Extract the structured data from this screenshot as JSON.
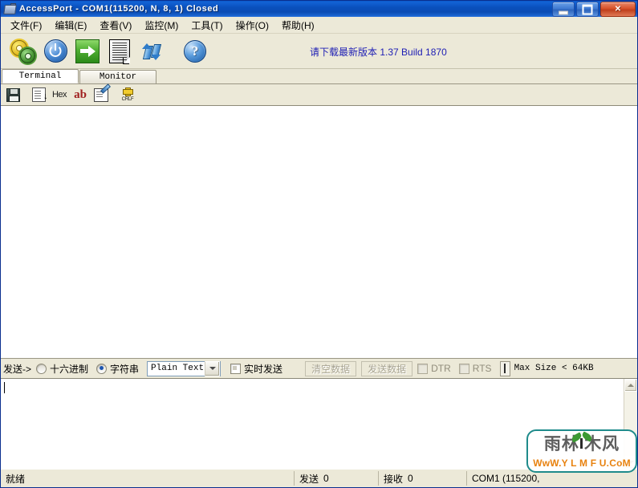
{
  "window": {
    "title": "AccessPort - COM1(115200, N, 8, 1) Closed",
    "icon": "serial-port-icon",
    "controls": {
      "minimize": "minimize-button",
      "maximize": "maximize-button",
      "close": "✕"
    }
  },
  "menubar": {
    "items": [
      {
        "label": "文件(F)",
        "name": "menu-file"
      },
      {
        "label": "编辑(E)",
        "name": "menu-edit"
      },
      {
        "label": "查看(V)",
        "name": "menu-view"
      },
      {
        "label": "监控(M)",
        "name": "menu-monitor"
      },
      {
        "label": "工具(T)",
        "name": "menu-tools"
      },
      {
        "label": "操作(O)",
        "name": "menu-operation"
      },
      {
        "label": "帮助(H)",
        "name": "menu-help"
      }
    ]
  },
  "toolbar": {
    "buttons": [
      {
        "name": "port-config-button",
        "icon": "gears-icon"
      },
      {
        "name": "open-close-port-button",
        "icon": "power-icon"
      },
      {
        "name": "send-button",
        "icon": "green-arrow-icon"
      },
      {
        "name": "document-button",
        "icon": "document-icon"
      },
      {
        "name": "refresh-button",
        "icon": "refresh-arrows-icon"
      },
      {
        "name": "help-button",
        "icon": "help-question-icon"
      }
    ],
    "version_note": "请下载最新版本 1.37 Build 1870"
  },
  "tabs": [
    {
      "label": "Terminal",
      "name": "tab-terminal",
      "active": true
    },
    {
      "label": "Monitor",
      "name": "tab-monitor",
      "active": false
    }
  ],
  "subtoolbar": {
    "buttons": [
      {
        "name": "save-log-button",
        "icon": "floppy-save-icon"
      },
      {
        "name": "scroll-to-end-button",
        "icon": "scroll-end-icon"
      },
      {
        "name": "hex-view-button",
        "icon": "hex-text-icon",
        "label": "Hex"
      },
      {
        "name": "ascii-view-button",
        "icon": "ab-text-icon",
        "label": "ab"
      },
      {
        "name": "edit-mode-button",
        "icon": "edit-check-icon"
      },
      {
        "name": "crlf-button",
        "icon": "crlf-icon",
        "label": "CRLF"
      }
    ]
  },
  "terminal": {
    "content": ""
  },
  "sendbar": {
    "send_label": "发送->",
    "radios": [
      {
        "label": "十六进制",
        "name": "radio-hex",
        "checked": false
      },
      {
        "label": "字符串",
        "name": "radio-string",
        "checked": true
      }
    ],
    "format_combo": {
      "value": "Plain Text",
      "name": "format-select"
    },
    "realtime_checkbox": {
      "label": "实时发送",
      "checked": false
    },
    "clear_button": "清空数据",
    "send_data_button": "发送数据",
    "dtr_checkbox": {
      "label": "DTR",
      "checked": false
    },
    "rts_checkbox": {
      "label": "RTS",
      "checked": false
    },
    "max_size_text": "Max Size < 64KB"
  },
  "input": {
    "value": "",
    "placeholder": ""
  },
  "statusbar": {
    "ready": "就绪",
    "sent_label": "发送",
    "sent_value": "0",
    "received_label": "接收",
    "received_value": "0",
    "port_info": "COM1 (115200,"
  },
  "watermark": {
    "chinese": "雨林  木风",
    "url": "WwW.Y L M F U.CoM"
  },
  "colors": {
    "title_blue": "#0b4cb4",
    "chrome": "#ece9d8",
    "version_text": "#1d1db4",
    "accent_green": "#3f8c2c",
    "watermark_teal": "#1f8b8b",
    "watermark_orange": "#e8820f"
  }
}
